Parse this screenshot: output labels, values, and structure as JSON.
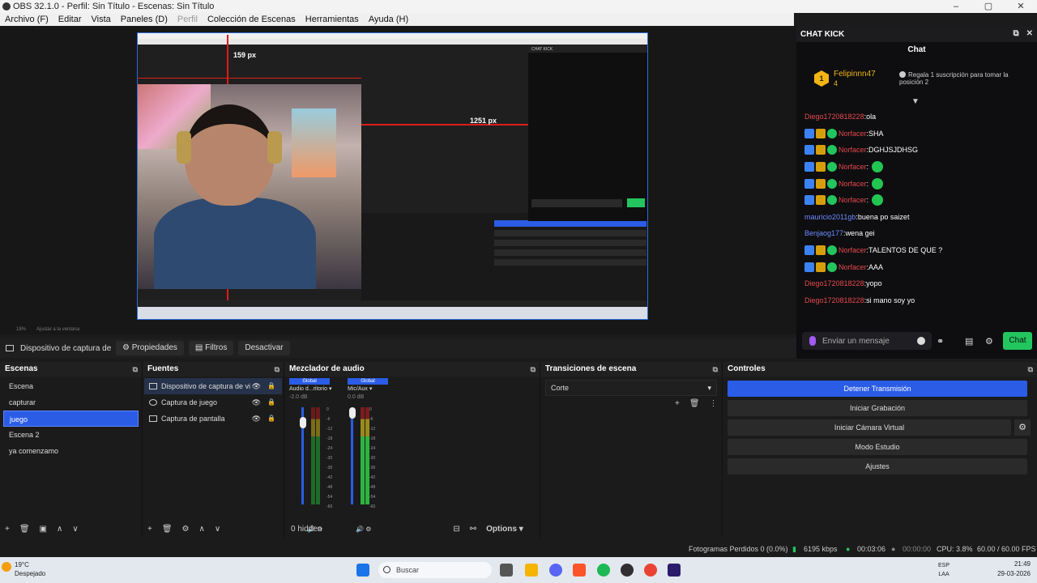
{
  "window": {
    "title": "OBS 32.1.0 - Perfil: Sin Título - Escenas: Sin Título",
    "controls": [
      "–",
      "▢",
      "✕"
    ]
  },
  "menu": [
    "Archivo (F)",
    "Editar",
    "Vista",
    "Paneles (D)",
    "Perfil",
    "Colección de Escenas",
    "Herramientas",
    "Ayuda (H)"
  ],
  "preview": {
    "measure_top": "159 px",
    "measure_right": "1251 px",
    "zoom_text": "Ajustar a la ventana",
    "zoom_pct": "18%"
  },
  "chat": {
    "dock_title": "CHAT KICK",
    "tab": "Chat",
    "pinned": {
      "user": "Felipinnn47",
      "count": "4",
      "badge": "1",
      "gift_text": "Regala 1 suscripción para tomar la posición 2"
    },
    "messages": [
      {
        "user": "Diego1720818228",
        "text": "ola",
        "color": "#e5484d",
        "badges": ""
      },
      {
        "user": "Norfacer",
        "text": "SHA",
        "color": "#e5484d",
        "badges": "byg"
      },
      {
        "user": "Norfacer",
        "text": "DGHJSJDHSG",
        "color": "#e5484d",
        "badges": "byg"
      },
      {
        "user": "Norfacer",
        "text": "",
        "color": "#e5484d",
        "badges": "byg",
        "emote": true
      },
      {
        "user": "Norfacer",
        "text": "",
        "color": "#e5484d",
        "badges": "byg",
        "emote": true
      },
      {
        "user": "Norfacer",
        "text": "",
        "color": "#e5484d",
        "badges": "byg",
        "emote": true
      },
      {
        "user": "mauricio2011gb",
        "text": "buena po saizet",
        "color": "#6b8cff",
        "badges": ""
      },
      {
        "user": "Benjaog177",
        "text": "wena gei",
        "color": "#6b8cff",
        "badges": ""
      },
      {
        "user": "Norfacer",
        "text": "TALENTOS DE QUE ?",
        "color": "#e5484d",
        "badges": "byg"
      },
      {
        "user": "Norfacer",
        "text": "AAA",
        "color": "#e5484d",
        "badges": "byg"
      },
      {
        "user": "Diego1720818228",
        "text": "yopo",
        "color": "#e5484d",
        "badges": ""
      },
      {
        "user": "Diego1720818228",
        "text": "si mano soy yo",
        "color": "#e5484d",
        "badges": ""
      }
    ],
    "input_placeholder": "Enviar un mensaje",
    "send_label": "Chat"
  },
  "source_toolbar": {
    "source_name": "Dispositivo de captura de v",
    "properties": "Propiedades",
    "filters": "Filtros",
    "deactivate": "Desactivar"
  },
  "scenes": {
    "title": "Escenas",
    "items": [
      "Escena",
      "capturar",
      "juego",
      "Escena 2",
      "ya comenzamo"
    ],
    "selected": 2
  },
  "sources": {
    "title": "Fuentes",
    "items": [
      "Dispositivo de captura de vi",
      "Captura de juego",
      "Captura de pantalla"
    ]
  },
  "mixer": {
    "title": "Mezclador de audio",
    "channels": [
      {
        "name": "Audio d...ritorio",
        "db": "-2.0 dB",
        "badge": "Global"
      },
      {
        "name": "Mic/Aux",
        "db": "0.0 dB",
        "badge": "Global"
      }
    ],
    "ticks": [
      "0",
      "-6",
      "-12",
      "-18",
      "-24",
      "-30",
      "-36",
      "-42",
      "-48",
      "-54",
      "-60"
    ],
    "hidden": "0 hidden",
    "options": "Options"
  },
  "transitions": {
    "title": "Transiciones de escena",
    "selected": "Corte"
  },
  "controls": {
    "title": "Controles",
    "buttons": [
      "Detener Transmisión",
      "Iniciar Grabación",
      "Iniciar Cámara Virtual",
      "Modo Estudio",
      "Ajustes"
    ]
  },
  "status": {
    "dropped": "Fotogramas Perdidos 0 (0.0%)",
    "kbps": "6195 kbps",
    "stream_time": "00:03:06",
    "rec_time": "00:00:00",
    "cpu": "CPU: 3.8%",
    "fps": "60.00 / 60.00 FPS"
  },
  "taskbar": {
    "weather_temp": "19°C",
    "weather_desc": "Despejado",
    "search": "Buscar",
    "lang1": "ESP",
    "lang2": "LAA",
    "time": "21:49",
    "date": "29-03-2026"
  }
}
